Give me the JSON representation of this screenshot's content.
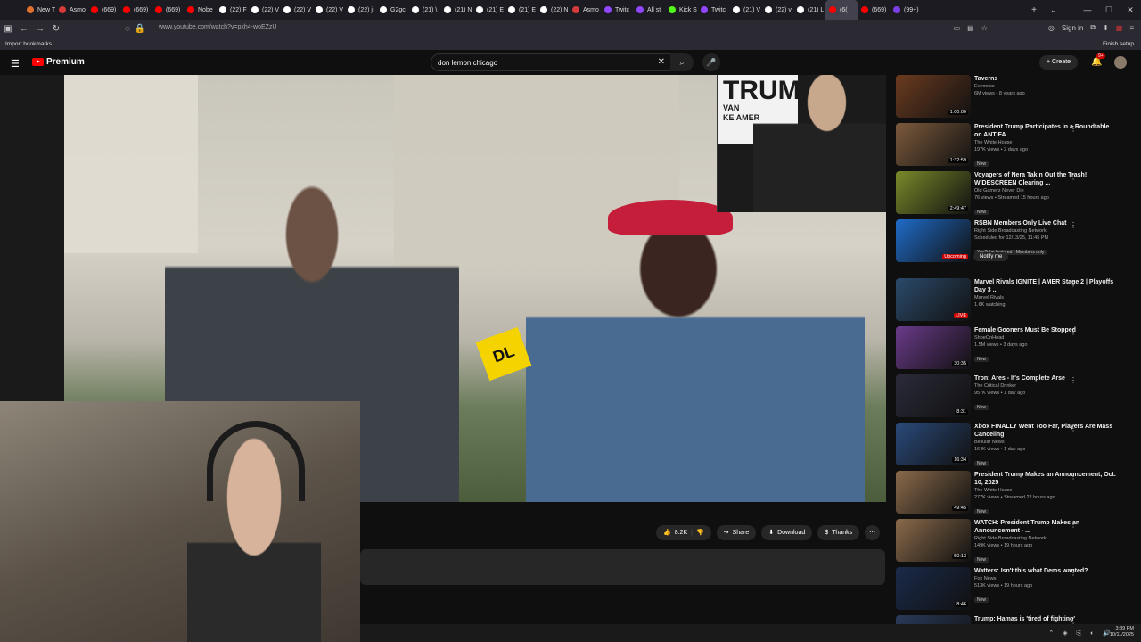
{
  "browser": {
    "tabs": [
      {
        "label": "New T",
        "color": "#e0702c"
      },
      {
        "label": "Asmo",
        "color": "#d63a3a"
      },
      {
        "label": "(669)",
        "color": "#ff0000"
      },
      {
        "label": "(669)",
        "color": "#ff0000"
      },
      {
        "label": "(669)",
        "color": "#ff0000"
      },
      {
        "label": "Nobe",
        "color": "#ff0000"
      },
      {
        "label": "(22) F",
        "color": "#ffffff"
      },
      {
        "label": "(22) V",
        "color": "#ffffff"
      },
      {
        "label": "(22) V",
        "color": "#ffffff"
      },
      {
        "label": "(22) V",
        "color": "#ffffff"
      },
      {
        "label": "(22) ji",
        "color": "#ffffff"
      },
      {
        "label": "G2gc",
        "color": "#ffffff"
      },
      {
        "label": "(21) \\",
        "color": "#ffffff"
      },
      {
        "label": "(21) N",
        "color": "#ffffff"
      },
      {
        "label": "(21) E",
        "color": "#ffffff"
      },
      {
        "label": "(21) E",
        "color": "#ffffff"
      },
      {
        "label": "(22) N",
        "color": "#ffffff"
      },
      {
        "label": "Asmo",
        "color": "#d63a3a"
      },
      {
        "label": "Twitc",
        "color": "#9146ff"
      },
      {
        "label": "All st",
        "color": "#9146ff"
      },
      {
        "label": "Kick S",
        "color": "#53fc18"
      },
      {
        "label": "Twitc",
        "color": "#9146ff"
      },
      {
        "label": "(21) V",
        "color": "#ffffff"
      },
      {
        "label": "(22) v",
        "color": "#ffffff"
      },
      {
        "label": "(21) L",
        "color": "#ffffff"
      },
      {
        "label": "(6(",
        "color": "#ff0000"
      },
      {
        "label": "(669)",
        "color": "#ff0000"
      },
      {
        "label": "(99+)",
        "color": "#7b3fe4"
      }
    ],
    "url": "www.youtube.com/watch?v=pxh4-woEZzU",
    "sign_in": "Sign in",
    "import_bookmarks": "Import bookmarks...",
    "finish_setup": "Finish setup"
  },
  "youtube": {
    "logo_text": "Premium",
    "search_query": "don lemon chicago",
    "create_label": "Create",
    "notif_count": "9+"
  },
  "video": {
    "mic_flag_text": "DL",
    "inset_sign": "TRUM",
    "inset_sign_sub": "VAN",
    "inset_sign_sub2": "KE AMER"
  },
  "actions": {
    "likes": "8.2K",
    "share": "Share",
    "download": "Download",
    "thanks": "Thanks"
  },
  "recommendations": [
    {
      "title": "Taverns",
      "channel": "Evemess",
      "meta": "6M views • 8 years ago",
      "duration": "1:00:00",
      "badge": "",
      "color": "#6b3b1f"
    },
    {
      "title": "President Trump Participates in a Roundtable on ANTIFA",
      "channel": "The White House",
      "meta": "197K views • 2 days ago",
      "duration": "1:32:59",
      "badge": "New",
      "color": "#7c5a3c"
    },
    {
      "title": "Voyagers of Nera Takin Out the Trash! WIDESCREEN Clearing ...",
      "channel": "Old Gamerz Never Die",
      "meta": "76 views • Streamed 15 hours ago",
      "duration": "2:49:47",
      "badge": "New",
      "color": "#7a8a2a"
    },
    {
      "title": "RSBN Members Only Live Chat",
      "channel": "Right Side Broadcasting Network",
      "meta": "Scheduled for 12/13/25, 11:45 PM",
      "duration": "Upcoming",
      "badge": "YouTube featured • Members only",
      "color": "#1f6cc9"
    },
    {
      "title": "Marvel Rivals IGNITE | AMER Stage 2 | Playoffs Day 3 ...",
      "channel": "Marvel Rivals",
      "meta": "1.6K watching",
      "duration": "LIVE",
      "badge": "",
      "color": "#2b4a6b"
    },
    {
      "title": "Female Gooners Must Be Stopped",
      "channel": "ShoeOnHead",
      "meta": "1.5M views • 3 days ago",
      "duration": "30:35",
      "badge": "New",
      "color": "#6a3a8a"
    },
    {
      "title": "Tron: Ares - It's Complete Arse",
      "channel": "The Critical Drinker",
      "meta": "957K views • 1 day ago",
      "duration": "8:31",
      "badge": "New",
      "color": "#2a2a3a"
    },
    {
      "title": "Xbox FINALLY Went Too Far, Players Are Mass Canceling",
      "channel": "Bellular News",
      "meta": "164K views • 1 day ago",
      "duration": "16:34",
      "badge": "New",
      "color": "#2a4a7a"
    },
    {
      "title": "President Trump Makes an Announcement, Oct. 10, 2025",
      "channel": "The White House",
      "meta": "277K views • Streamed 22 hours ago",
      "duration": "49:45",
      "badge": "New",
      "color": "#8a6a4a"
    },
    {
      "title": "WATCH: President Trump Makes an Announcement - ...",
      "channel": "Right Side Broadcasting Network",
      "meta": "149K views • 19 hours ago",
      "duration": "50:13",
      "badge": "New",
      "color": "#8a6a4a"
    },
    {
      "title": "Watters: Isn't this what Dems wanted?",
      "channel": "Fox News",
      "meta": "513K views • 19 hours ago",
      "duration": "8:46",
      "badge": "New",
      "color": "#1a2a4a"
    },
    {
      "title": "Trump: Hamas is 'tired of fighting'",
      "channel": "",
      "meta": "",
      "duration": "",
      "badge": "",
      "color": "#2a3a5a"
    }
  ],
  "notify_me": "Notify me",
  "taskbar": {
    "time": "3:39 PM",
    "date": "10/11/2025"
  }
}
